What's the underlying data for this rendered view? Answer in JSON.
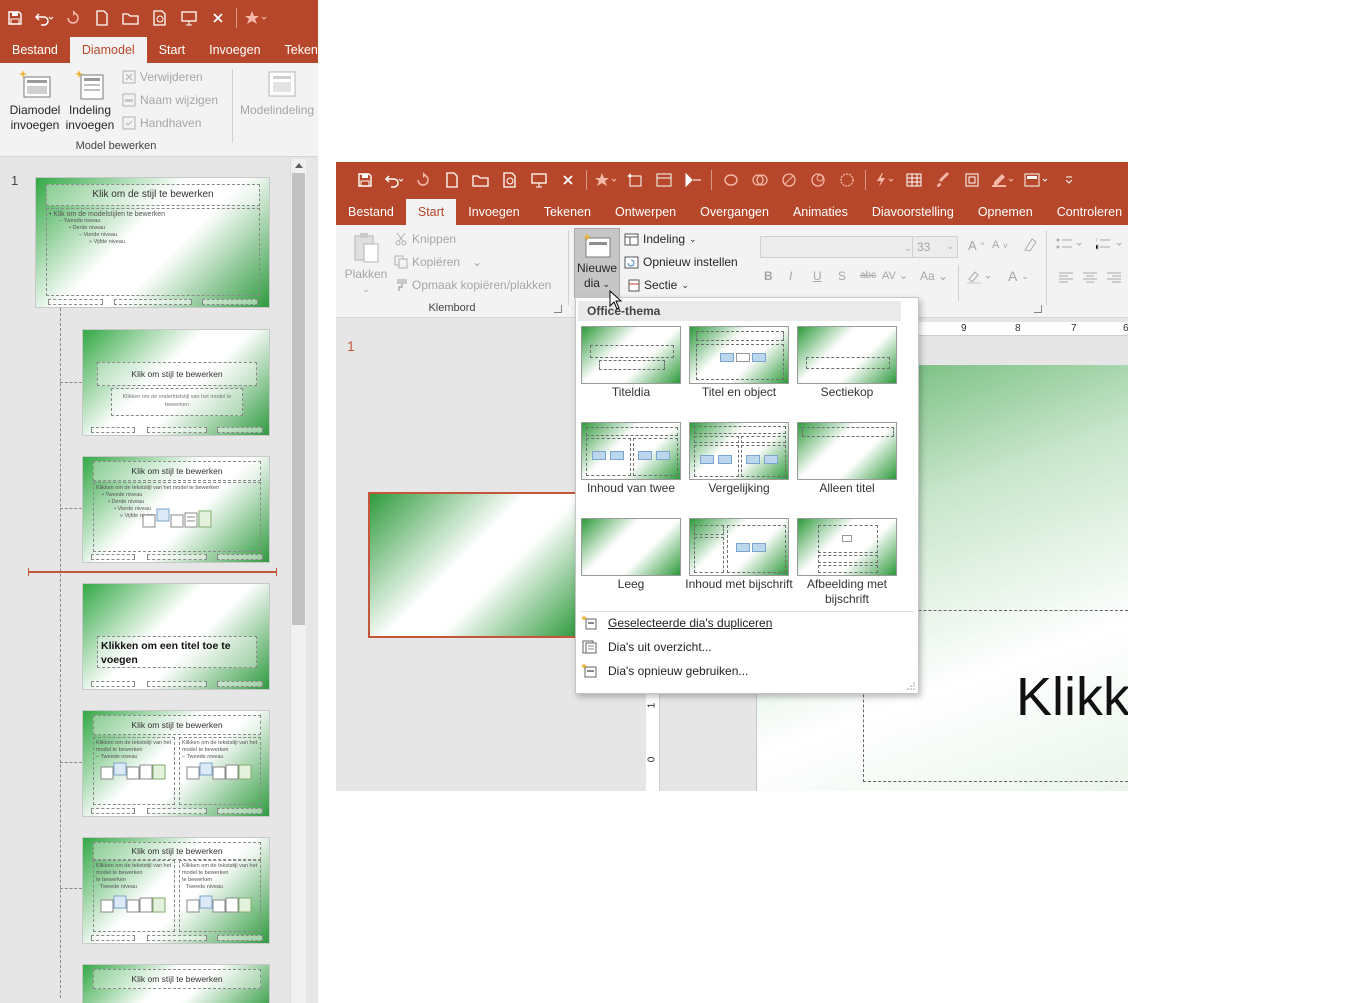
{
  "back_window": {
    "tabs": [
      "Bestand",
      "Diamodel",
      "Start",
      "Invoegen",
      "Tekenen"
    ],
    "active_tab": "Diamodel",
    "ribbon": {
      "insert_master": "Diamodel invoegen",
      "insert_layout": "Indeling invoegen",
      "delete": "Verwijderen",
      "rename": "Naam wijzigen",
      "preserve": "Handhaven",
      "master_layout": "Modelindeling",
      "group_label": "Model bewerken"
    },
    "slide_number": "1",
    "thumbs": {
      "master_title": "Klik om de stijl te bewerken",
      "master_body": [
        "• Klik om de modelstijlen te bewerken",
        "– Tweede niveau",
        "• Derde niveau",
        "– Vierde niveau",
        "» Vijfde niveau"
      ],
      "t2_title": "Klik om stijl te bewerken",
      "t2_sub": "Klikken om de ondertitelstijl van het model te bewerken",
      "t3_title": "Klik om stijl te bewerken",
      "t3_body": [
        "Klikken om de tekststijl van het model te bewerken",
        "• Tweede niveau",
        "• Derde niveau",
        "• Vierde niveau",
        "» Vijfde niveau"
      ],
      "t4_title": "Klikken om een titel toe te voegen",
      "t5_title": "Klik om stijl te bewerken",
      "t5_col": "Klikken om de tekststijl van het model te bewerken",
      "t5_col2": "– Tweede niveau",
      "t6_title": "Klik om stijl te bewerken",
      "t6_col": "Klikken om de tekststijl van het model te bewerken",
      "t6_col2": "te bewerken",
      "t6_col3": "Tweede niveau",
      "t7_title": "Klik om stijl te bewerken"
    }
  },
  "front_window": {
    "tabs": [
      "Bestand",
      "Start",
      "Invoegen",
      "Tekenen",
      "Ontwerpen",
      "Overgangen",
      "Animaties",
      "Diavoorstelling",
      "Opnemen",
      "Controleren"
    ],
    "active_tab": "Start",
    "ribbon": {
      "paste": "Plakken",
      "cut": "Knippen",
      "copy": "Kopiëren",
      "format_painter": "Opmaak kopiëren/plakken",
      "clipboard_group": "Klembord",
      "new_slide_line1": "Nieuwe",
      "new_slide_line2": "dia",
      "layout": "Indeling",
      "reset": "Opnieuw instellen",
      "section": "Sectie",
      "font_size": "33"
    },
    "slide_number": "1",
    "ruler_marks": [
      "9",
      "8",
      "7",
      "6"
    ],
    "vruler_marks": [
      "1",
      "0"
    ],
    "canvas_text": "Klikk"
  },
  "dropdown": {
    "header": "Office-thema",
    "layouts": [
      {
        "label": "Titeldia"
      },
      {
        "label": "Titel en object"
      },
      {
        "label": "Sectiekop"
      },
      {
        "label": "Inhoud van twee"
      },
      {
        "label": "Vergelijking"
      },
      {
        "label": "Alleen titel"
      },
      {
        "label": "Leeg"
      },
      {
        "label": "Inhoud met bijschrift"
      },
      {
        "label": "Afbeelding met bijschrift"
      }
    ],
    "actions": [
      {
        "label": "Geselecteerde dia's dupliceren"
      },
      {
        "label": "Dia's uit overzicht..."
      },
      {
        "label": "Dia's opnieuw gebruiken..."
      }
    ]
  },
  "colors": {
    "accent": "#b7472a",
    "ribbon": "#f3f3f3",
    "slide_green": "#2e9a3c"
  }
}
